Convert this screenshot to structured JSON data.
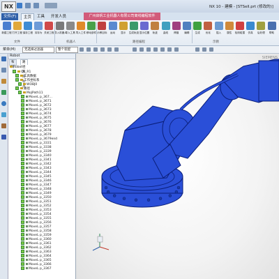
{
  "app": {
    "logo": "NX",
    "window_title": "NX 10 - 建模 - [STSell.prt (修改的)]"
  },
  "tabs": [
    "文件(F)",
    "主页",
    "工具",
    "开发人员"
  ],
  "active_tab": "主页",
  "banner_text": "广州启帆工业机器人有限公司离线编程软件",
  "ribbon": {
    "buttons": [
      {
        "label": "新建工程",
        "color": "#4a7fd0"
      },
      {
        "label": "打开工程",
        "color": "#e1a83a"
      },
      {
        "label": "保存工程",
        "color": "#3d8bd4"
      },
      {
        "label": "另存为",
        "color": "#6d9bd8"
      },
      {
        "label": "关闭工程",
        "color": "#d04a4a"
      },
      {
        "label": "导入机器人",
        "color": "#7a7a7a"
      },
      {
        "label": "导入工具",
        "color": "#8a8a8a"
      },
      {
        "label": "导入工件",
        "color": "#e08a2a"
      },
      {
        "label": "移动部件",
        "color": "#4aa04a"
      },
      {
        "label": "示教目标",
        "color": "#c04040"
      },
      {
        "label": "运动",
        "color": "#5a8ad0"
      },
      {
        "label": "显示",
        "color": "#d0a030"
      },
      {
        "label": "生成轨迹",
        "color": "#3a9a6a"
      },
      {
        "label": "显示位置",
        "color": "#6a6ad0"
      },
      {
        "label": "轨迹",
        "color": "#c08040"
      },
      {
        "label": "曲线",
        "color": "#40a0c0"
      },
      {
        "label": "焊缝",
        "color": "#a04080"
      },
      {
        "label": "编辑",
        "color": "#5080c0"
      },
      {
        "label": "生成",
        "color": "#40a040"
      },
      {
        "label": "优化",
        "color": "#c06040"
      },
      {
        "label": "插入",
        "color": "#6a9ad0"
      },
      {
        "label": "属性",
        "color": "#d08a3a"
      },
      {
        "label": "检测碰撞",
        "color": "#d04040"
      },
      {
        "label": "仿真",
        "color": "#3a8ad0"
      },
      {
        "label": "后处理",
        "color": "#a0a040"
      },
      {
        "label": "帮助",
        "color": "#4a70b0"
      }
    ],
    "groups": [
      "文件",
      "机器人",
      "路径编程",
      "示教"
    ]
  },
  "cmdbar": {
    "menu_label": "菜单(M)",
    "filter_value": "无选择过滤器",
    "scope_value": "整个装配"
  },
  "navigator": {
    "header": "Robot",
    "tabs": [
      "布局",
      "路径和目标点"
    ],
    "active_tab": "路径和目标点",
    "tree": [
      {
        "label": "Robot",
        "level": 0,
        "check": false
      },
      {
        "label": "QF_R1",
        "level": 1,
        "check": true
      },
      {
        "label": "工具数据",
        "level": 2,
        "check": true
      },
      {
        "label": "工作坐标系",
        "level": 2,
        "check": true
      },
      {
        "label": "WOBJ0",
        "level": 3,
        "check": true
      },
      {
        "label": "路径",
        "level": 2,
        "check": true
      },
      {
        "label": "MoJPath11",
        "level": 3,
        "check": true
      },
      {
        "label": "MoveL p_367...",
        "level": 4,
        "check": true
      },
      {
        "label": "MoveL p_3671",
        "level": 4,
        "check": true
      },
      {
        "label": "MoveL p_3672",
        "level": 4,
        "check": true
      },
      {
        "label": "MoveL p_3673",
        "level": 4,
        "check": true
      },
      {
        "label": "MoveL p_3674",
        "level": 4,
        "check": true
      },
      {
        "label": "MoveL p_3675",
        "level": 4,
        "check": true
      },
      {
        "label": "MoveL p_3676",
        "level": 4,
        "check": true
      },
      {
        "label": "MoveL p_3677",
        "level": 4,
        "check": true
      },
      {
        "label": "MoveL p_3678",
        "level": 4,
        "check": true
      },
      {
        "label": "MoveL p_3679",
        "level": 4,
        "check": true
      },
      {
        "label": "MoveL p_3679end",
        "level": 4,
        "check": true
      },
      {
        "label": "MoveL p_3331",
        "level": 4,
        "check": true
      },
      {
        "label": "MoveL p_3338",
        "level": 4,
        "check": true
      },
      {
        "label": "MoveL p_3339",
        "level": 4,
        "check": true
      },
      {
        "label": "MoveL p_3340",
        "level": 4,
        "check": true
      },
      {
        "label": "MoveL p_3341",
        "level": 4,
        "check": true
      },
      {
        "label": "MoveL p_3342",
        "level": 4,
        "check": true
      },
      {
        "label": "MoveL p_3343",
        "level": 4,
        "check": true
      },
      {
        "label": "MoveL p_3344",
        "level": 4,
        "check": true
      },
      {
        "label": "MoveL p_3345",
        "level": 4,
        "check": true
      },
      {
        "label": "MoveL p_3346",
        "level": 4,
        "check": true
      },
      {
        "label": "MoveL p_3347",
        "level": 4,
        "check": true
      },
      {
        "label": "MoveL p_3348",
        "level": 4,
        "check": true
      },
      {
        "label": "MoveL p_3349",
        "level": 4,
        "check": true
      },
      {
        "label": "MoveL p_3350",
        "level": 4,
        "check": true
      },
      {
        "label": "MoveL p_3351",
        "level": 4,
        "check": true
      },
      {
        "label": "MoveL p_3352",
        "level": 4,
        "check": true
      },
      {
        "label": "MoveL p_3353",
        "level": 4,
        "check": true
      },
      {
        "label": "MoveL p_3354",
        "level": 4,
        "check": true
      },
      {
        "label": "MoveL p_3355",
        "level": 4,
        "check": true
      },
      {
        "label": "MoveL p_3356",
        "level": 4,
        "check": true
      },
      {
        "label": "MoveL p_3357",
        "level": 4,
        "check": true
      },
      {
        "label": "MoveL p_3358",
        "level": 4,
        "check": true
      },
      {
        "label": "MoveL p_3359",
        "level": 4,
        "check": true
      },
      {
        "label": "MoveL p_3360",
        "level": 4,
        "check": true
      },
      {
        "label": "MoveL p_3361",
        "level": 4,
        "check": true
      },
      {
        "label": "MoveL p_3362",
        "level": 4,
        "check": true
      },
      {
        "label": "MoveL p_3363",
        "level": 4,
        "check": true
      },
      {
        "label": "MoveL p_3364",
        "level": 4,
        "check": true
      },
      {
        "label": "MoveL p_3365",
        "level": 4,
        "check": true
      },
      {
        "label": "MoveL p_3366",
        "level": 4,
        "check": true
      },
      {
        "label": "MoveL p_3367",
        "level": 4,
        "check": true
      }
    ]
  },
  "viewport": {
    "watermark": "SIEMENS",
    "model_color": "#2a4fd8",
    "model_edge_color": "#0b1f7a"
  }
}
